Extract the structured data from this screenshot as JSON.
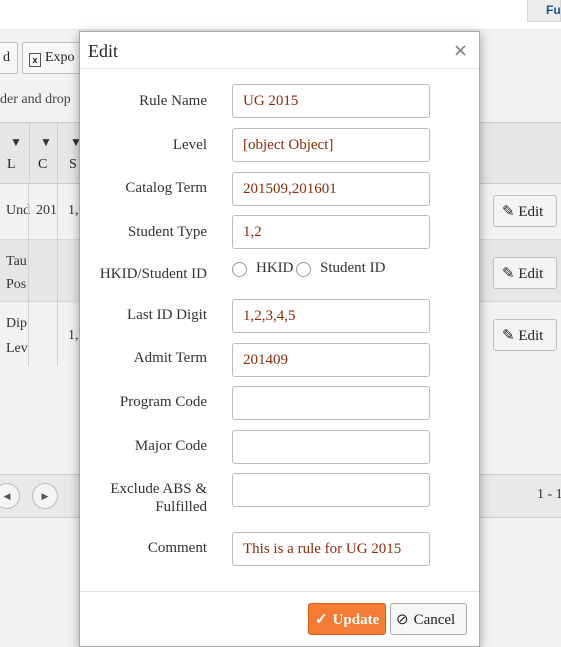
{
  "background": {
    "top_button": "Fu",
    "toolbar": [
      {
        "label": "d"
      },
      {
        "icon": "excel-icon",
        "label": "Expo"
      }
    ],
    "drop_hint": "der and drop",
    "columns": [
      {
        "label": "L"
      },
      {
        "label": "C"
      },
      {
        "label": "S"
      }
    ],
    "rows": [
      {
        "cells": [
          "Und",
          "201",
          "1,"
        ],
        "edit": "Edit"
      },
      {
        "cells": [
          "Tau",
          "Pos"
        ],
        "edit": "Edit"
      },
      {
        "cells": [
          "Dip",
          "Lev",
          "1,"
        ],
        "edit": "Edit"
      }
    ],
    "pager_info": "1 - 1"
  },
  "modal": {
    "title": "Edit",
    "close": "×",
    "fields": {
      "rule_name": {
        "label": "Rule Name",
        "value": "UG 2015"
      },
      "level": {
        "label": "Level",
        "value": "[object Object]"
      },
      "catalog_term": {
        "label": "Catalog Term",
        "value": "201509,201601"
      },
      "student_type": {
        "label": "Student Type",
        "value": "1,2"
      },
      "hkid_student_id": {
        "label": "HKID/Student ID",
        "options": [
          "HKID",
          "Student ID"
        ]
      },
      "last_id_digit": {
        "label": "Last ID Digit",
        "value": "1,2,3,4,5"
      },
      "admit_term": {
        "label": "Admit Term",
        "value": "201409"
      },
      "program_code": {
        "label": "Program Code",
        "value": ""
      },
      "major_code": {
        "label": "Major Code",
        "value": ""
      },
      "exclude_abs": {
        "label_line1": "Exclude ABS &",
        "label_line2": "Fulfilled",
        "value": ""
      },
      "comment": {
        "label": "Comment",
        "value": "This is a rule for UG 2015"
      }
    },
    "buttons": {
      "update": "Update",
      "cancel": "Cancel"
    }
  }
}
